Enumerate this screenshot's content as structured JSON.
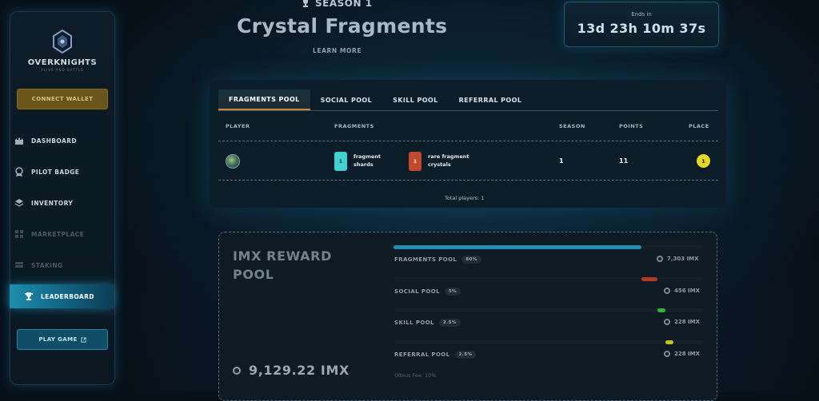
{
  "sidebar": {
    "logo_text": "OVERKNIGHTS",
    "logo_sub": "ALIVE AND BATTLE",
    "connect_wallet": "CONNECT WALLET",
    "items": [
      {
        "label": "DASHBOARD",
        "icon": "castle-icon",
        "state": "normal"
      },
      {
        "label": "PILOT BADGE",
        "icon": "badge-icon",
        "state": "normal"
      },
      {
        "label": "INVENTORY",
        "icon": "layers-icon",
        "state": "normal"
      },
      {
        "label": "MARKETPLACE",
        "icon": "grid-icon",
        "state": "disabled"
      },
      {
        "label": "STAKING",
        "icon": "stack-icon",
        "state": "disabled"
      },
      {
        "label": "LEADERBOARD",
        "icon": "trophy-icon",
        "state": "active"
      }
    ],
    "play_game": "PLAY GAME"
  },
  "header": {
    "season": "SEASON 1",
    "title": "Crystal Fragments",
    "learn_more": "LEARN MORE",
    "timer_label": "Ends in",
    "timer_value": "13d 23h 10m 37s"
  },
  "leaderboard": {
    "tabs": [
      "FRAGMENTS POOL",
      "SOCIAL POOL",
      "SKILL POOL",
      "REFERRAL POOL"
    ],
    "active_tab": 0,
    "columns": [
      "PLAYER",
      "FRAGMENTS",
      "SEASON",
      "POINTS",
      "PLACE"
    ],
    "rows": [
      {
        "fragments": [
          {
            "count": "1",
            "label_line1": "fragment",
            "label_line2": "shards",
            "color": "#3fd3d0"
          },
          {
            "count": "1",
            "label_line1": "rare fragment",
            "label_line2": "crystals",
            "color": "#c24a2a"
          }
        ],
        "season": "1",
        "points": "11",
        "place": "1"
      }
    ],
    "total_players": "Total players: 1"
  },
  "reward_pool": {
    "title": "IMX REWARD POOL",
    "total": "9,129.22 IMX",
    "pools": [
      {
        "name": "FRAGMENTS POOL",
        "pct": "80%",
        "amount": "7,303 IMX",
        "fill": 0.8,
        "color": "#1f8fb4"
      },
      {
        "name": "SOCIAL POOL",
        "pct": "5%",
        "amount": "456 IMX",
        "fill": 0.05,
        "color": "#b23a22"
      },
      {
        "name": "SKILL POOL",
        "pct": "2.5%",
        "amount": "228 IMX",
        "fill": 0.025,
        "color": "#2fb82f"
      },
      {
        "name": "REFERRAL POOL",
        "pct": "2.5%",
        "amount": "228 IMX",
        "fill": 0.025,
        "color": "#c9c21a"
      }
    ],
    "fee_note": "Olbius Fee: 10%"
  }
}
